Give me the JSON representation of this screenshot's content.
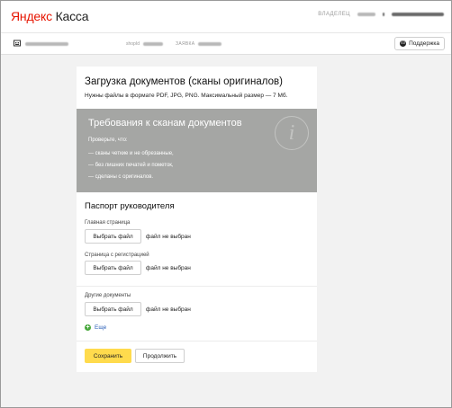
{
  "header": {
    "logo_brand": "Яндекс",
    "logo_product": "Касса",
    "role_label": "ВЛАДЕЛЕЦ"
  },
  "subheader": {
    "shop_id_label": "shopId",
    "claim_label": "ЗАЯВКА",
    "support_label": "Поддержка"
  },
  "page": {
    "title": "Загрузка документов (сканы оригиналов)",
    "subtitle": "Нужны файлы в формате PDF, JPG, PNG. Максимальный размер — 7 Мб."
  },
  "requirements": {
    "title": "Требования к сканам документов",
    "lead": "Проверьте, что:",
    "items": [
      "— сканы четкие и не обрезанные,",
      "— без лишних печатей и пометок,",
      "— сделаны с оригиналов."
    ],
    "icon": "info-icon"
  },
  "passport": {
    "title": "Паспорт руководителя",
    "fields": [
      {
        "label": "Главная страница",
        "button": "Выбрать файл",
        "status": "файл не выбран"
      },
      {
        "label": "Страница с регистрацией",
        "button": "Выбрать файл",
        "status": "файл не выбран"
      }
    ]
  },
  "other": {
    "label": "Другие документы",
    "button": "Выбрать файл",
    "status": "файл не выбран",
    "more_label": "Еще"
  },
  "actions": {
    "save": "Сохранить",
    "continue": "Продолжить"
  },
  "colors": {
    "brand_red": "#e61400",
    "accent_yellow": "#ffdb4d",
    "requirements_bg": "#a5a6a4",
    "link_blue": "#2a5fb8",
    "add_green": "#48a83c"
  }
}
